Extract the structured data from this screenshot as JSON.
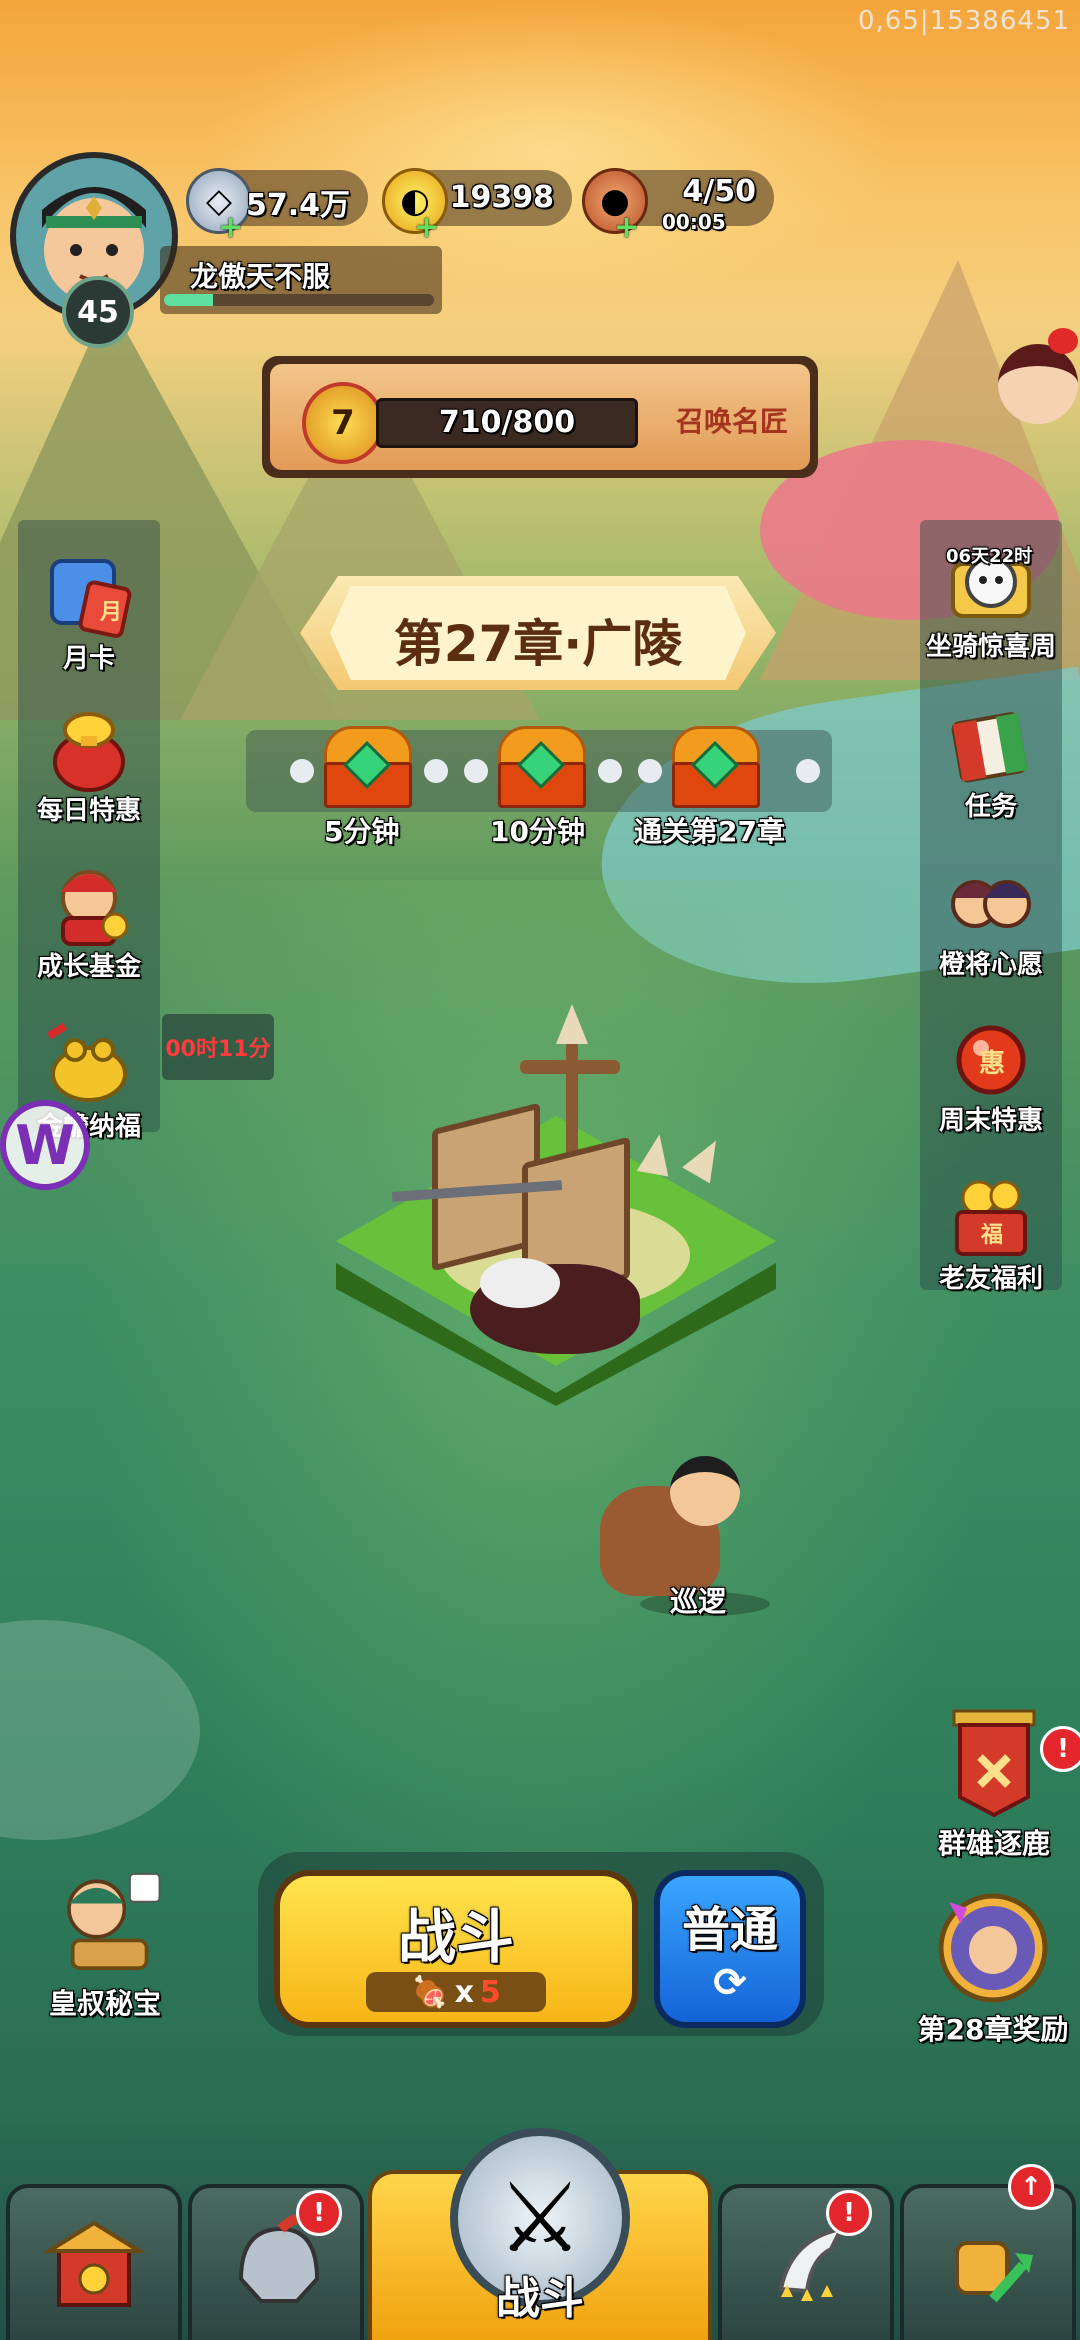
{
  "debug": "0,65|15386451",
  "player": {
    "name": "龙傲天不服",
    "level": "45",
    "exp_fraction": 0.18
  },
  "resources": [
    {
      "icon": "silver-coin-icon",
      "value": "57.4万"
    },
    {
      "icon": "gold-ingot-icon",
      "value": "19398"
    },
    {
      "icon": "meat-stamina-icon",
      "value": "4/50",
      "timer": "00:05"
    }
  ],
  "level_box": {
    "medal": "7",
    "progress": "710/800",
    "progress_fraction": 0.8875,
    "summon": "召唤名匠"
  },
  "left_menu": [
    {
      "label": "月卡"
    },
    {
      "label": "每日特惠"
    },
    {
      "label": "成长基金"
    },
    {
      "label": "金蟾纳福",
      "timer": "00时11分"
    }
  ],
  "right_menu": [
    {
      "label": "坐骑惊喜周",
      "badge": "06天22时"
    },
    {
      "label": "任务"
    },
    {
      "label": "橙将心愿"
    },
    {
      "label": "周末特惠"
    },
    {
      "label": "老友福利"
    }
  ],
  "chapter": {
    "title": "第27章·广陵"
  },
  "chests": [
    {
      "label": "5分钟"
    },
    {
      "label": "10分钟"
    },
    {
      "label": "通关第27章"
    }
  ],
  "patrol": {
    "label": "巡逻"
  },
  "corner": {
    "left": {
      "label": "皇叔秘宝"
    },
    "right_top": {
      "label": "群雄逐鹿"
    },
    "right_bottom": {
      "label": "第28章奖励"
    }
  },
  "battle": {
    "label": "战斗",
    "cost_x": "x",
    "cost_n": "5",
    "mode_label": "普通",
    "mode_icon": "⟳"
  },
  "nav": {
    "center_label": "战斗"
  }
}
